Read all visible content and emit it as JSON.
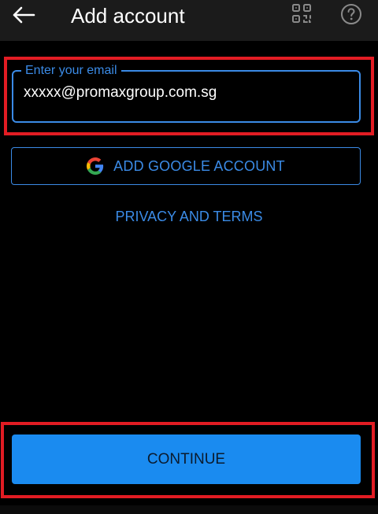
{
  "header": {
    "title": "Add account",
    "back_icon": "arrow-left-icon",
    "qr_icon": "qr-code-icon",
    "help_icon": "help-circle-icon"
  },
  "email": {
    "label": "Enter your email",
    "value": "xxxxx@promaxgroup.com.sg"
  },
  "google_button": {
    "icon": "google-logo-icon",
    "label": "ADD GOOGLE ACCOUNT"
  },
  "privacy_link": "PRIVACY AND TERMS",
  "continue_button": {
    "label": "CONTINUE"
  },
  "colors": {
    "background": "#000000",
    "toolbar": "#1b1b1b",
    "accent": "#3b8be6",
    "primary_button": "#1a8bf0",
    "annotation_red": "#e21c23"
  }
}
